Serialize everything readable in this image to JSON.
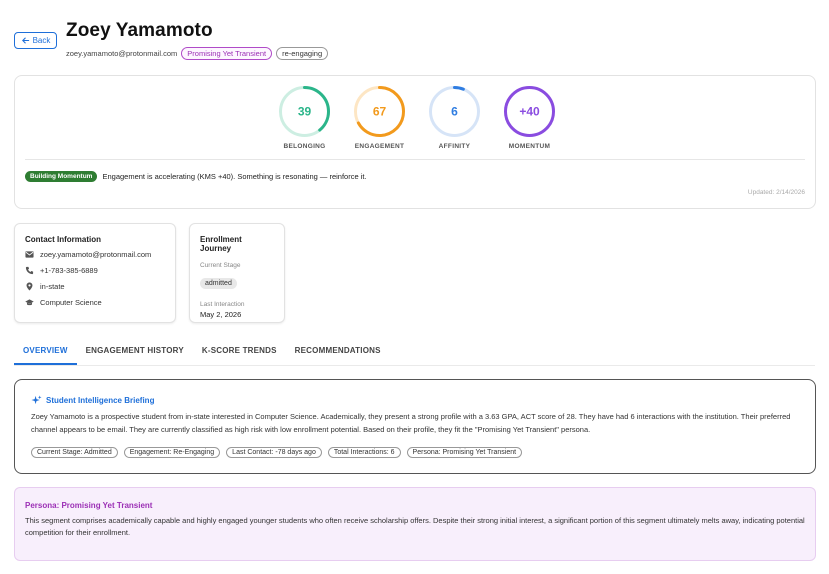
{
  "header": {
    "back_label": "Back",
    "name": "Zoey Yamamoto",
    "email": "zoey.yamamoto@protonmail.com",
    "persona_pill": "Promising Yet Transient",
    "status_pill": "re-engaging"
  },
  "kscores": {
    "gauges": [
      {
        "value": "39",
        "label": "BELONGING",
        "fill": 0.39,
        "color": "#2bb58a",
        "track": "#cdeee2"
      },
      {
        "value": "67",
        "label": "ENGAGEMENT",
        "fill": 0.67,
        "color": "#f29a1d",
        "track": "#fde6c4"
      },
      {
        "value": "6",
        "label": "AFFINITY",
        "fill": 0.06,
        "color": "#2f7de1",
        "track": "#d6e4f7"
      },
      {
        "value": "+40",
        "label": "MOMENTUM",
        "fill": 1.0,
        "color": "#8a4ce0",
        "track": "#e5d8f7"
      }
    ],
    "momentum_badge": "Building Momentum",
    "momentum_text": "Engagement is accelerating (KMS +40). Something is resonating — reinforce it.",
    "updated": "Updated: 2/14/2026"
  },
  "contact": {
    "title": "Contact Information",
    "email": "zoey.yamamoto@protonmail.com",
    "phone": "+1-783-385-6889",
    "residency": "in-state",
    "major": "Computer Science"
  },
  "enrollment": {
    "title": "Enrollment Journey",
    "stage_label": "Current Stage",
    "stage_value": "admitted",
    "last_label": "Last Interaction",
    "last_value": "May 2, 2026"
  },
  "tabs": [
    "OVERVIEW",
    "ENGAGEMENT HISTORY",
    "K-SCORE TRENDS",
    "RECOMMENDATIONS"
  ],
  "briefing": {
    "title": "Student Intelligence Briefing",
    "text": "Zoey Yamamoto is a prospective student from in-state interested in Computer Science. Academically, they present a strong profile with a 3.63 GPA, ACT score of 28. They have had 6 interactions with the institution. Their preferred channel appears to be email. They are currently classified as high risk with low enrollment potential. Based on their profile, they fit the \"Promising Yet Transient\" persona.",
    "chips": [
      "Current Stage: Admitted",
      "Engagement: Re-Engaging",
      "Last Contact: -78 days ago",
      "Total Interactions: 6",
      "Persona: Promising Yet Transient"
    ]
  },
  "persona": {
    "title": "Persona: Promising Yet Transient",
    "text": "This segment comprises academically capable and highly engaged younger students who often receive scholarship offers. Despite their strong initial interest, a significant portion of this segment ultimately melts away, indicating potential competition for their enrollment."
  }
}
